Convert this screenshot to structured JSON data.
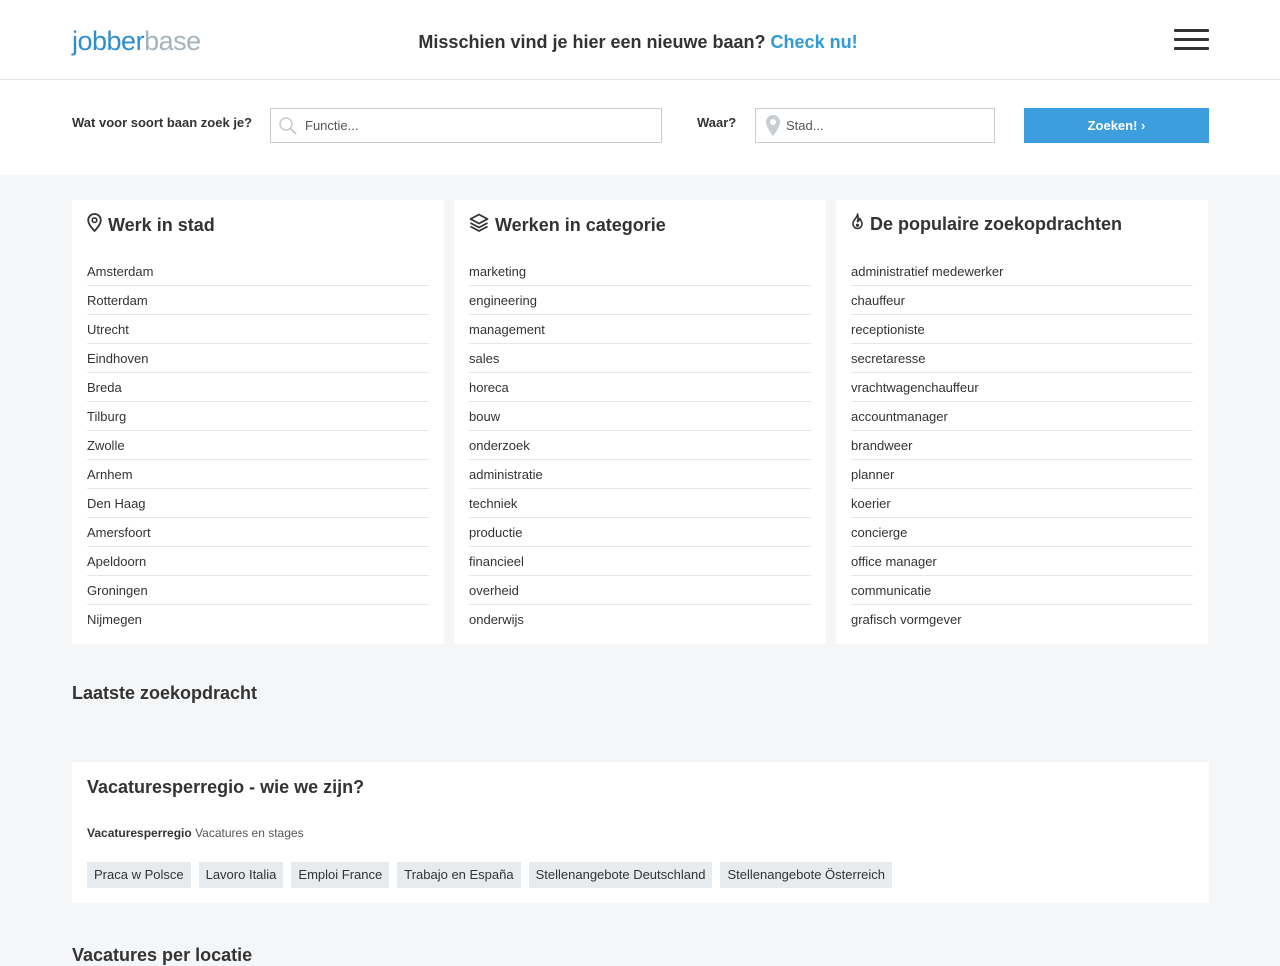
{
  "header": {
    "logo_part1": "jobber",
    "logo_part2": "base",
    "tagline": "Misschien vind je hier een nieuwe baan?",
    "tagline_cta": "Check nu!"
  },
  "search": {
    "what_label": "Wat voor soort baan zoek je?",
    "what_placeholder": "Functie...",
    "what_value": "",
    "where_label": "Waar?",
    "where_placeholder": "Stad...",
    "where_value": "",
    "button_label": "Zoeken! ›"
  },
  "cards": {
    "cities": {
      "title": "Werk in stad",
      "icon": "map-pin-icon",
      "items": [
        "Amsterdam",
        "Rotterdam",
        "Utrecht",
        "Eindhoven",
        "Breda",
        "Tilburg",
        "Zwolle",
        "Arnhem",
        "Den Haag",
        "Amersfoort",
        "Apeldoorn",
        "Groningen",
        "Nijmegen"
      ]
    },
    "categories": {
      "title": "Werken in categorie",
      "icon": "layers-icon",
      "items": [
        "marketing",
        "engineering",
        "management",
        "sales",
        "horeca",
        "bouw",
        "onderzoek",
        "administratie",
        "techniek",
        "productie",
        "financieel",
        "overheid",
        "onderwijs"
      ]
    },
    "popular": {
      "title": "De populaire zoekopdrachten",
      "icon": "flame-icon",
      "items": [
        "administratief medewerker",
        "chauffeur",
        "receptioniste",
        "secretaresse",
        "vrachtwagenchauffeur",
        "accountmanager",
        "brandweer",
        "planner",
        "koerier",
        "concierge",
        "office manager",
        "communicatie",
        "grafisch vormgever"
      ]
    }
  },
  "latest": {
    "title": "Laatste zoekopdracht"
  },
  "about": {
    "title": "Vacaturesperregio - wie we zijn?",
    "brand": "Vacaturesperregio",
    "description": "Vacatures en stages",
    "tags": [
      "Praca w Polsce",
      "Lavoro Italia",
      "Emploi France",
      "Trabajo en España",
      "Stellenangebote Deutschland",
      "Stellenangebote Österreich"
    ]
  },
  "per_location": {
    "title": "Vacatures per locatie"
  },
  "colors": {
    "accent": "#2e9bd9",
    "button": "#3d9ede",
    "logo_secondary": "#a6b3bd"
  }
}
